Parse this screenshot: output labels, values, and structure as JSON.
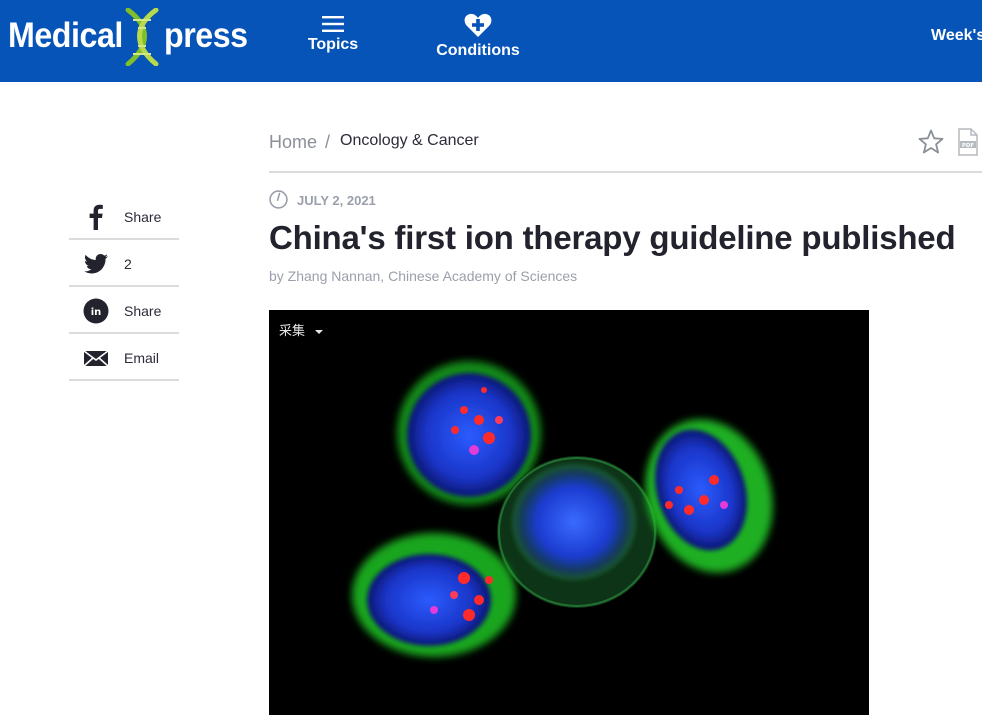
{
  "header": {
    "logo_left": "Medical",
    "logo_right": "press",
    "nav": [
      {
        "label": "Topics",
        "icon": "menu-icon"
      },
      {
        "label": "Conditions",
        "icon": "heart-plus-icon"
      }
    ],
    "weeks_label": "Week's",
    "background": "#0654b8"
  },
  "share": {
    "items": [
      {
        "icon": "facebook-icon",
        "label": "Share"
      },
      {
        "icon": "twitter-icon",
        "label": "2"
      },
      {
        "icon": "linkedin-icon",
        "label": "Share"
      },
      {
        "icon": "email-icon",
        "label": "Email"
      }
    ]
  },
  "breadcrumb": {
    "home": "Home",
    "separator": "/",
    "category": "Oncology & Cancer"
  },
  "article": {
    "date": "JULY 2, 2021",
    "title": "China's first ion therapy guideline published",
    "byline": "by Zhang Nannan, Chinese Academy of Sciences",
    "image_tag": "采集"
  }
}
